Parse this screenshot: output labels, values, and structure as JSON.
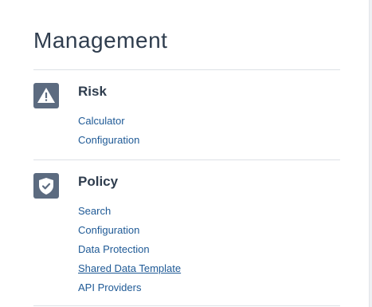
{
  "page": {
    "title": "Management"
  },
  "sections": [
    {
      "heading": "Risk",
      "icon": "warning-icon",
      "links": [
        "Calculator",
        "Configuration"
      ]
    },
    {
      "heading": "Policy",
      "icon": "shield-check-icon",
      "links": [
        "Search",
        "Configuration",
        "Data Protection",
        "Shared Data Template",
        "API Providers"
      ],
      "hovered_link": "Shared Data Template"
    }
  ],
  "colors": {
    "heading": "#2f3d4e",
    "link": "#1f5a96",
    "icon_background": "#5c6b80",
    "divider": "#dde1e6"
  }
}
